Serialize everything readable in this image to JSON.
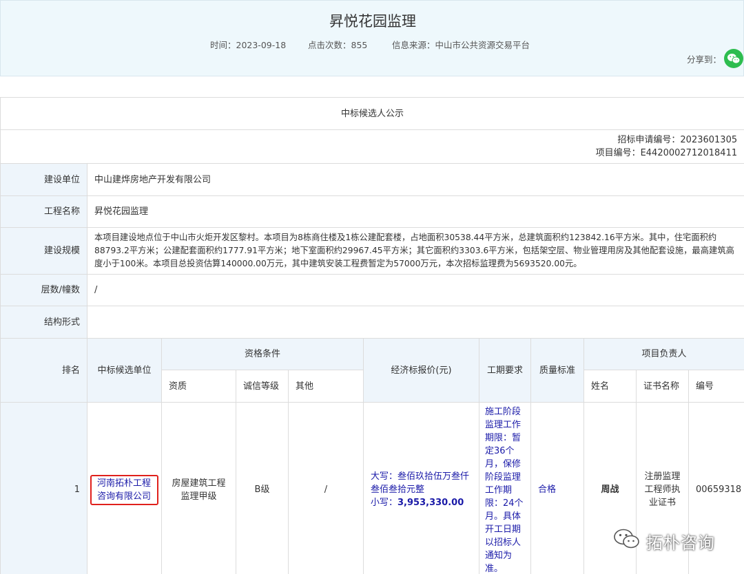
{
  "page": {
    "title": "昇悦花园监理",
    "time": "时间：2023-09-18",
    "clicks": "点击次数：855",
    "source": "信息来源：中山市公共资源交易平台",
    "share_label": "分享到："
  },
  "icons": {
    "share": "wechat-icon",
    "watermark": "wechat-logo-icon"
  },
  "colors": {
    "header_bg": "#eef8fc",
    "label_bg": "#eef5fb",
    "link_blue": "#1a1aa8",
    "highlight_red": "#e0201c",
    "wechat_green": "#2dbd4f"
  },
  "notice": {
    "heading": "中标候选人公示",
    "bid_application_no": "招标申请编号：2023601305",
    "project_no": "项目编号：E4420002712018411"
  },
  "info": {
    "builder_label": "建设单位",
    "builder_value": "中山建烨房地产开发有限公司",
    "project_label": "工程名称",
    "project_value": "昇悦花园监理",
    "scale_label": "建设规模",
    "scale_value": "本项目建设地点位于中山市火炬开发区黎村。本项目为8栋商住楼及1栋公建配套楼，占地面积30538.44平方米，总建筑面积约123842.16平方米。其中，住宅面积约88793.2平方米；公建配套面积约1777.91平方米；地下室面积约29967.45平方米；其它面积约3303.6平方米，包括架空层、物业管理用房及其他配套设施，最高建筑高度小于100米。本项目总投资估算140000.00万元，其中建筑安装工程费暂定为57000万元，本次招标监理费为5693520.00元。",
    "floors_label": "层数/幢数",
    "floors_value": "/",
    "structure_label": "结构形式",
    "structure_value": ""
  },
  "table_headers": {
    "rank": "排名",
    "candidate": "中标候选单位",
    "qualification": "资格条件",
    "qual_grade": "资质",
    "credit": "诚信等级",
    "other": "其他",
    "price": "经济标报价(元)",
    "period": "工期要求",
    "quality": "质量标准",
    "leader": "项目负责人",
    "name": "姓名",
    "cert_name": "证书名称",
    "cert_no": "编号"
  },
  "candidates": [
    {
      "rank": "1",
      "company": "河南拓朴工程咨询有限公司",
      "qualification": "房屋建筑工程监理甲级",
      "credit": "B级",
      "other": "/",
      "price_upper": "大写：叁佰玖拾伍万叁仟叁佰叁拾元整",
      "price_lower_label": "小写：",
      "price_lower_value": "3,953,330.00",
      "period": "施工阶段监理工作期限：暂定36个月，保修阶段监理工作期限：24个月。具体开工日期以招标人通知为准。",
      "quality": "合格",
      "leader_name": "周战",
      "cert_name": "注册监理工程师执业证书",
      "cert_no": "00659318"
    }
  ],
  "watermark": {
    "text": "拓朴咨询"
  }
}
